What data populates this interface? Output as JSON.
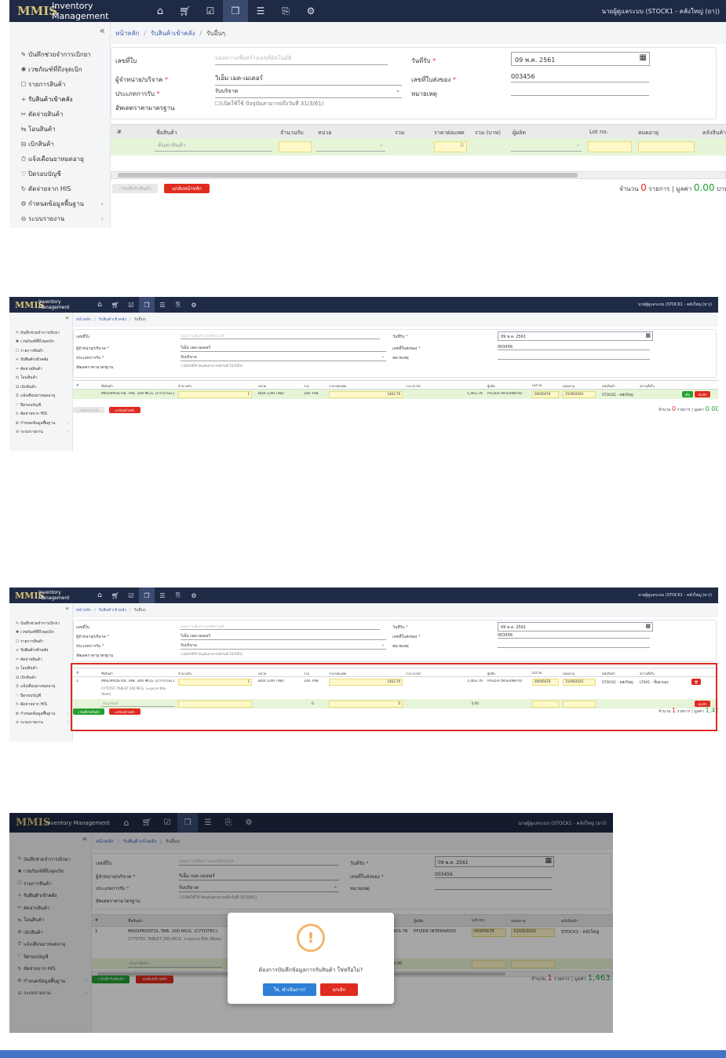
{
  "app": {
    "title": "Inventory Management",
    "logo": "MMIS",
    "user": "นายผู้ดูแลระบบ (STOCK1 - คลังใหญ่ (ยา))"
  },
  "nav_icons": [
    "home-icon",
    "cart-icon",
    "checklist-icon",
    "box-icon",
    "database-icon",
    "document-icon",
    "gear-icon"
  ],
  "sidebar": {
    "collapse": "«",
    "items": [
      {
        "label": "บันทึกช่วยจำการเบิกยา",
        "icon": "✎"
      },
      {
        "label": "เวชภัณฑ์ที่ถึงจุดเบิก",
        "icon": "✺"
      },
      {
        "label": "รายการสินค้า",
        "icon": "☐"
      },
      {
        "label": "รับสินค้าเข้าคลัง",
        "icon": "+"
      },
      {
        "label": "ตัดจ่ายสินค้า",
        "icon": "✂"
      },
      {
        "label": "โอนสินค้า",
        "icon": "⇆"
      },
      {
        "label": "เบิกสินค้า",
        "icon": "⊟"
      },
      {
        "label": "แจ้งเตือนยาหมดอายุ",
        "icon": "⏱"
      },
      {
        "label": "ปิดรอบบัญชี",
        "icon": "♡"
      },
      {
        "label": "ตัดจ่ายจาก HIS",
        "icon": "↻"
      },
      {
        "label": "กำหนดข้อมูลพื้นฐาน",
        "icon": "⚙"
      },
      {
        "label": "ระบบรายงาน",
        "icon": "⊖"
      }
    ]
  },
  "breadcrumb": {
    "home": "หน้าหลัก",
    "parent": "รับสินค้าเข้าคลัง",
    "current": "รับอื่นๆ"
  },
  "form": {
    "doc_no_label": "เลขที่ใบ",
    "doc_no_placeholder": "ปล่อยว่างเพื่อสร้างเลขที่อัตโนมัติ",
    "date_label": "วันที่รับ",
    "date_value": "09 พ.ค. 2561",
    "vendor_label": "ผู้จำหน่าย/บริจาค",
    "vendor_value": "วิเอ็ม เมด-เมเดอร์",
    "delivery_label": "เลขที่ใบส่งของ",
    "delivery_value": "003456",
    "type_label": "ประเภทการรับ",
    "type_value": "รับบริจาค",
    "remark_label": "หมายเหตุ",
    "std_label": "อัพเดตราคามาตรฐาน",
    "std_note": "(เปิดใช้ใช้ ปัจจุบันสามารถถึงวันที่ 31/3/61)"
  },
  "table": {
    "headers": [
      "#",
      "ชื่อสินค้า",
      "จำนวนรับ",
      "หน่วย",
      "รวม",
      "ราคาต่อแพค",
      "รวม (บาท)",
      "ผู้ผลิต",
      "Lot no.",
      "หมดอายุ",
      "คลังสินค้า",
      "สถานที่เก็บ"
    ],
    "search_placeholder": "ค้นหาสินค้า",
    "row": {
      "no": "1",
      "name": "MISOPROSTOL TAB. 200 MCG. (CYTOTEC)",
      "name_detail": "CYTOTEC TABLET 200 MCG. ระบุหน่วย ยี่ห้อ (พิเศษ)",
      "qty": "1",
      "unit": "BOX (140 TAB)",
      "total": "140 TAB",
      "price": "1463.76",
      "amount": "1,463.76",
      "maker": "PFIZER INTERNATIO",
      "lot": "00005678",
      "expire": "15/09/2020",
      "warehouse": "STOCK1 - คลังใหญ่",
      "location": "LT001 - ชั้นยาแผง"
    },
    "add_label": "เพิ่ม",
    "cancel_label": "ยกเลิก",
    "zero": "0",
    "zero_amount": "0.00"
  },
  "buttons": {
    "save": "บันทึกรับสินค้า",
    "back": "กลับหน้าหลัก"
  },
  "summary": {
    "prefix": "จำนวน",
    "items_zero": "0",
    "items_one": "1",
    "mid": "รายการ | มูลค่า",
    "value_zero": "0.00",
    "value_one": "1,463.76",
    "suffix": "บาท"
  },
  "modal": {
    "icon": "!",
    "message": "ต้องการบันทึกข้อมูลการรับสินค้า ใช่หรือไม่?",
    "confirm": "ใช่, ดำเนินการ!",
    "cancel": "ยกเลิก"
  },
  "colors": {
    "navbar": "#1f2a45",
    "accent_green": "#24a032",
    "accent_red": "#e02b20",
    "highlight": "#e02b20",
    "footer": "#4472c4"
  }
}
